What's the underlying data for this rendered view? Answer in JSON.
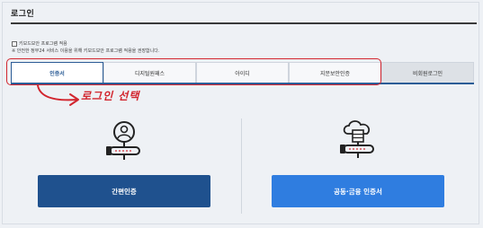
{
  "page": {
    "title": "로그인"
  },
  "options": {
    "keyboard_security": "키보드보안 프로그램 적용",
    "notice": "※ 안전한 정부24 서비스 이용을 위해 키보드보안 프로그램 적용을 권장합니다."
  },
  "tabs": [
    {
      "label": "인증서"
    },
    {
      "label": "디지털원패스"
    },
    {
      "label": "아이디"
    },
    {
      "label": "지문보안인증"
    },
    {
      "label": "비회원로그인"
    }
  ],
  "annotation": {
    "text": "로그인 선택",
    "color": "#d2252e"
  },
  "buttons": {
    "simple_auth": "간편인증",
    "joint_cert": "공동·금융 인증서"
  },
  "colors": {
    "primary": "#1f518e",
    "secondary": "#2f7de0",
    "highlight": "#d2252e"
  },
  "icons": [
    "user-key-icon",
    "cloud-key-icon",
    "arrow-icon"
  ]
}
